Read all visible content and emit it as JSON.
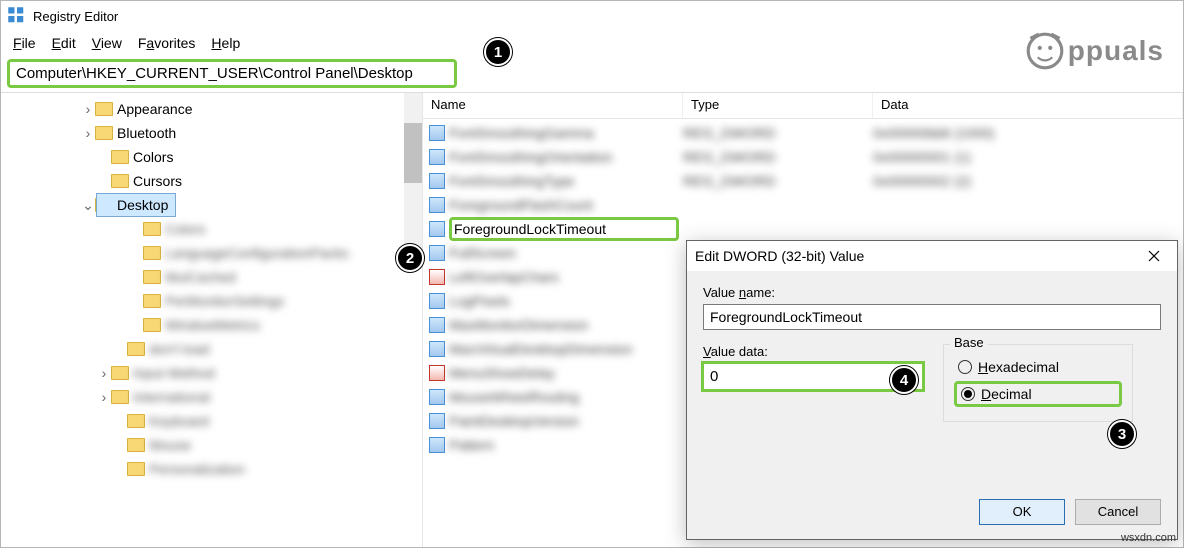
{
  "app": {
    "title": "Registry Editor"
  },
  "menu": {
    "file": "File",
    "edit": "Edit",
    "view": "View",
    "favorites": "Favorites",
    "help": "Help"
  },
  "address": "Computer\\HKEY_CURRENT_USER\\Control Panel\\Desktop",
  "tree": {
    "items": [
      {
        "indent": 80,
        "expander": ">",
        "label": "Appearance",
        "blur": false
      },
      {
        "indent": 80,
        "expander": ">",
        "label": "Bluetooth",
        "blur": false
      },
      {
        "indent": 96,
        "expander": "",
        "label": "Colors",
        "blur": false
      },
      {
        "indent": 96,
        "expander": "",
        "label": "Cursors",
        "blur": false
      },
      {
        "indent": 80,
        "expander": "v",
        "label": "Desktop",
        "blur": false,
        "selected": true
      },
      {
        "indent": 128,
        "expander": "",
        "label": "Colors",
        "blur": true
      },
      {
        "indent": 128,
        "expander": "",
        "label": "LanguageConfigurationPacks",
        "blur": true
      },
      {
        "indent": 128,
        "expander": "",
        "label": "MuiCached",
        "blur": true
      },
      {
        "indent": 128,
        "expander": "",
        "label": "PerMonitorSettings",
        "blur": true
      },
      {
        "indent": 128,
        "expander": "",
        "label": "WindowMetrics",
        "blur": true
      },
      {
        "indent": 112,
        "expander": "",
        "label": "don't load",
        "blur": true
      },
      {
        "indent": 96,
        "expander": ">",
        "label": "Input Method",
        "blur": true
      },
      {
        "indent": 96,
        "expander": ">",
        "label": "International",
        "blur": true
      },
      {
        "indent": 112,
        "expander": "",
        "label": "Keyboard",
        "blur": true
      },
      {
        "indent": 112,
        "expander": "",
        "label": "Mouse",
        "blur": true
      },
      {
        "indent": 112,
        "expander": "",
        "label": "Personalization",
        "blur": true
      }
    ]
  },
  "columns": {
    "name": "Name",
    "type": "Type",
    "data": "Data"
  },
  "values": [
    {
      "name": "FontSmoothingGamma",
      "type": "REG_DWORD",
      "data": "0x00000bb8 (1000)",
      "icon": "reg",
      "blur": true
    },
    {
      "name": "FontSmoothingOrientation",
      "type": "REG_DWORD",
      "data": "0x00000001 (1)",
      "icon": "reg",
      "blur": true
    },
    {
      "name": "FontSmoothingType",
      "type": "REG_DWORD",
      "data": "0x00000002 (2)",
      "icon": "reg",
      "blur": true
    },
    {
      "name": "ForegroundFlashCount",
      "type": "",
      "data": "",
      "icon": "reg",
      "blur": true
    },
    {
      "name": "ForegroundLockTimeout",
      "type": "",
      "data": "",
      "icon": "reg",
      "blur": false,
      "focus": true
    },
    {
      "name": "FullScreen",
      "type": "",
      "data": "",
      "icon": "reg",
      "blur": true
    },
    {
      "name": "LeftOverlapChars",
      "type": "",
      "data": "",
      "icon": "red",
      "blur": true
    },
    {
      "name": "LogPixels",
      "type": "",
      "data": "",
      "icon": "reg",
      "blur": true
    },
    {
      "name": "MaxMonitorDimension",
      "type": "",
      "data": "",
      "icon": "reg",
      "blur": true
    },
    {
      "name": "MaxVirtualDesktopDimension",
      "type": "",
      "data": "",
      "icon": "reg",
      "blur": true
    },
    {
      "name": "MenuShowDelay",
      "type": "",
      "data": "",
      "icon": "red",
      "blur": true
    },
    {
      "name": "MouseWheelRouting",
      "type": "",
      "data": "",
      "icon": "reg",
      "blur": true
    },
    {
      "name": "PaintDesktopVersion",
      "type": "",
      "data": "",
      "icon": "reg",
      "blur": true
    },
    {
      "name": "Pattern",
      "type": "",
      "data": "",
      "icon": "reg",
      "blur": true
    }
  ],
  "dialog": {
    "title": "Edit DWORD (32-bit) Value",
    "valueNameLabel": "Value name:",
    "valueName": "ForegroundLockTimeout",
    "valueDataLabel": "Value data:",
    "valueData": "0",
    "baseLabel": "Base",
    "hex": "Hexadecimal",
    "dec": "Decimal",
    "ok": "OK",
    "cancel": "Cancel"
  },
  "callouts": {
    "c1": "1",
    "c2": "2",
    "c3": "3",
    "c4": "4"
  },
  "watermark": "ppuals",
  "credit": "wsxdn.com"
}
